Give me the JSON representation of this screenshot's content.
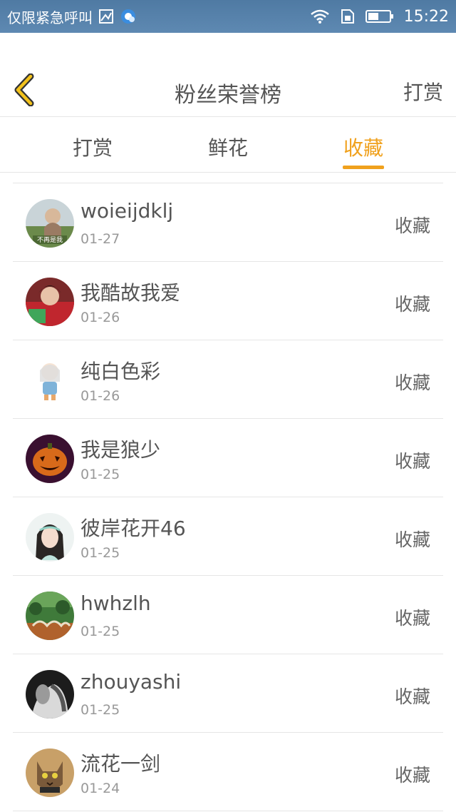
{
  "status": {
    "carrier": "仅限紧急呼叫",
    "time": "15:22",
    "icons": [
      "image-icon",
      "app-icon",
      "wifi-icon",
      "sim-icon",
      "battery-icon"
    ]
  },
  "header": {
    "title": "粉丝荣誉榜",
    "action": "打赏",
    "back_icon": "chevron-left-icon",
    "accent": "#f0a11d"
  },
  "tabs": [
    {
      "label": "打赏",
      "active": false
    },
    {
      "label": "鲜花",
      "active": false
    },
    {
      "label": "收藏",
      "active": true
    }
  ],
  "list": [
    {
      "name": "woieijdklj",
      "date": "01-27",
      "action": "收藏",
      "avatar_text": "不再是我"
    },
    {
      "name": "我酷故我爱",
      "date": "01-26",
      "action": "收藏"
    },
    {
      "name": "纯白色彩",
      "date": "01-26",
      "action": "收藏"
    },
    {
      "name": "我是狼少",
      "date": "01-25",
      "action": "收藏"
    },
    {
      "name": "彼岸花开46",
      "date": "01-25",
      "action": "收藏"
    },
    {
      "name": "hwhzlh",
      "date": "01-25",
      "action": "收藏"
    },
    {
      "name": "zhouyashi",
      "date": "01-25",
      "action": "收藏"
    },
    {
      "name": "流花一剑",
      "date": "01-24",
      "action": "收藏"
    }
  ]
}
